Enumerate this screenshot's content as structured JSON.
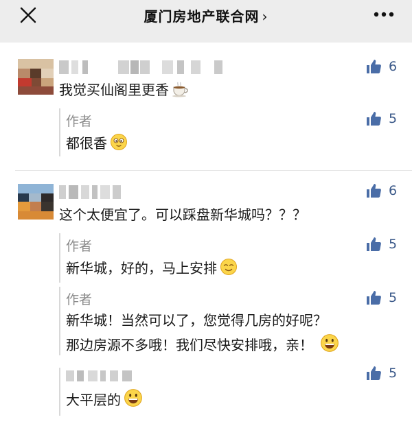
{
  "header": {
    "title": "厦门房地产联合网",
    "chevron": "›"
  },
  "comments": [
    {
      "text": "我觉买仙阁里更香",
      "likes": "6",
      "emoji_icon": "coffee-icon",
      "reply": {
        "author": "作者",
        "text": "都很香",
        "likes": "5",
        "emoji_icon": "drooling-face-icon"
      }
    },
    {
      "text": "这个太便宜了。可以踩盘新华城吗？？？",
      "likes": "6",
      "replies": [
        {
          "author": "作者",
          "text": "新华城，好的，马上安排",
          "likes": "5",
          "emoji_icon": "relieved-face-icon"
        },
        {
          "author": "作者",
          "line1": "新华城！当然可以了，您觉得几房的好呢？",
          "line2": "那边房源不多哦！我们尽快安排哦，亲！",
          "likes": "5",
          "emoji_icon": "grin-face-icon"
        },
        {
          "text": "大平层的",
          "likes": "5",
          "emoji_icon": "grin-face-icon"
        }
      ]
    }
  ],
  "icons": {
    "close": "close-icon",
    "more": "more-icon",
    "like": "thumbs-up-icon"
  },
  "colors": {
    "like_blue": "#4a6da7",
    "count_blue": "#3c5a8a",
    "author_gray": "#8a8a8a",
    "background": "#ededed"
  }
}
